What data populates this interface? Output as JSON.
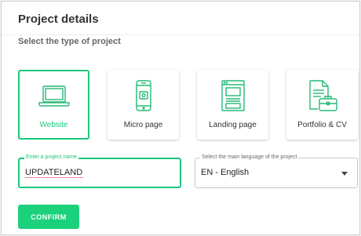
{
  "dialog": {
    "title": "Project details",
    "subtitle": "Select the type of project"
  },
  "project_types": [
    {
      "label": "Website",
      "icon": "laptop-icon",
      "selected": true
    },
    {
      "label": "Micro page",
      "icon": "smartphone-icon",
      "selected": false
    },
    {
      "label": "Landing page",
      "icon": "landing-page-icon",
      "selected": false
    },
    {
      "label": "Portfolio & CV",
      "icon": "portfolio-icon",
      "selected": false
    }
  ],
  "project_name": {
    "label": "Enter a project name",
    "value": "UPDATELAND"
  },
  "language": {
    "label": "Select the main language of the project",
    "value": "EN - English"
  },
  "confirm_label": "CONFIRM",
  "colors": {
    "accent": "#1bc77c",
    "icon": "#26b878"
  }
}
